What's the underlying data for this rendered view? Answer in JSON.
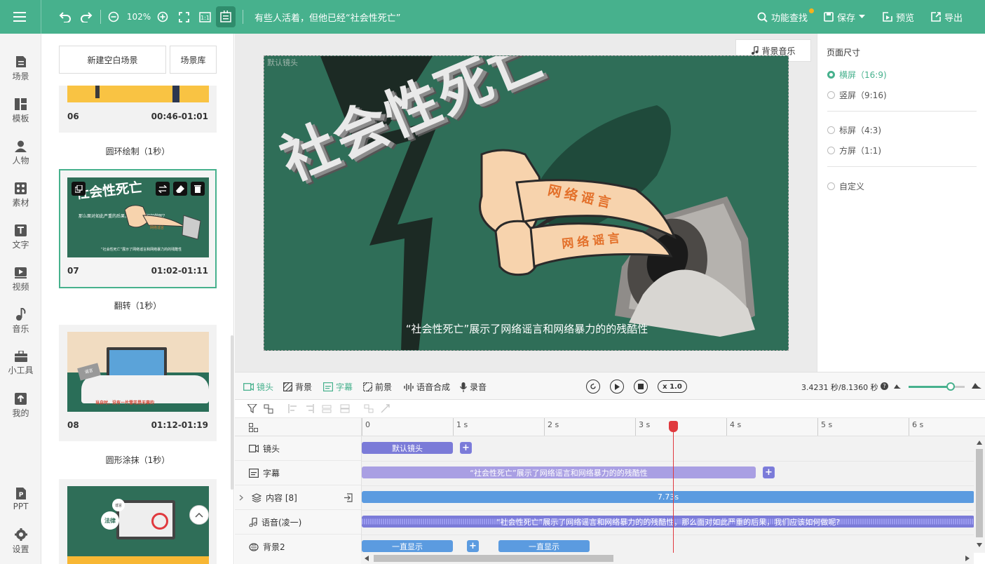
{
  "topbar": {
    "zoom": "102%",
    "project_title": "有些人活着，但他已经“社会性死亡”",
    "feature_search": "功能查找",
    "save": "保存",
    "preview": "预览",
    "export": "导出"
  },
  "nav": {
    "items": [
      {
        "label": "场景",
        "icon": "scene-icon"
      },
      {
        "label": "模板",
        "icon": "template-icon"
      },
      {
        "label": "人物",
        "icon": "person-icon"
      },
      {
        "label": "素材",
        "icon": "material-icon"
      },
      {
        "label": "文字",
        "icon": "text-icon"
      },
      {
        "label": "视频",
        "icon": "video-icon"
      },
      {
        "label": "音乐",
        "icon": "music-icon"
      },
      {
        "label": "小工具",
        "icon": "toolbox-icon"
      },
      {
        "label": "我的",
        "icon": "upload-icon"
      }
    ],
    "ppt": "PPT",
    "settings": "设置"
  },
  "scenes": {
    "new_blank": "新建空白场景",
    "library": "场景库",
    "cards": [
      {
        "num": "06",
        "time": "00:46-01:01"
      },
      {
        "num": "07",
        "time": "01:02-01:11",
        "thumb_title": "社会性死亡",
        "thumb_q": "那么面对如此严重的后果，我们应该如何做呢？",
        "thumb_caption": "“社会性死亡”展示了网络谣言和网络暴力的的残酷性",
        "thumb_tag": "网络谣言"
      },
      {
        "num": "08",
        "time": "01:12-01:19",
        "thumb_tag": "谣言",
        "thumb_caption": "当自时，没有一片雪花是无辜的"
      },
      {
        "num": "",
        "time": "",
        "thumb_tag": "法律",
        "thumb_tag2": "谣言"
      }
    ],
    "transitions": [
      "圆环绘制（1秒）",
      "翻转（1秒）",
      "圆形涂抹（1秒）"
    ]
  },
  "canvas": {
    "bg_music": "背景音乐",
    "default_shot": "默认镜头",
    "title": "社会性死亡",
    "finger_text_1": "网络谣言",
    "finger_text_2": "网络谣言",
    "subtitle": "“社会性死亡”展示了网络谣言和网络暴力的的残酷性"
  },
  "page_size": {
    "title": "页面尺寸",
    "options": [
      {
        "label": "横屏（16:9)",
        "selected": true
      },
      {
        "label": "竖屏（9:16)",
        "selected": false
      },
      {
        "label": "标屏（4:3)",
        "selected": false
      },
      {
        "label": "方屏（1:1)",
        "selected": false
      },
      {
        "label": "自定义",
        "selected": false
      }
    ]
  },
  "timeline": {
    "tabs": [
      "镜头",
      "背景",
      "字幕",
      "前景",
      "语音合成",
      "录音"
    ],
    "speed": "x 1.0",
    "time_display": "3.4231 秒/8.1360 秒",
    "zoom_level": 0.75,
    "playhead_seconds": 3.4231,
    "ruler": [
      "0",
      "1 s",
      "2 s",
      "3 s",
      "4 s",
      "5 s",
      "6 s"
    ],
    "rows": [
      {
        "label": "镜头",
        "icon": "camera-icon"
      },
      {
        "label": "字幕",
        "icon": "subtitle-icon"
      },
      {
        "label": "内容 [8]",
        "icon": "expand-icon"
      },
      {
        "label": "语音(凌一)",
        "icon": "voice-icon"
      },
      {
        "label": "背景2",
        "icon": "background-icon"
      }
    ],
    "clips": {
      "shot": "默认镜头",
      "subtitle": "“社会性死亡”展示了网络谣言和网络暴力的的残酷性",
      "content": "7.73s",
      "voice": "“社会性死亡”展示了网络谣言和网络暴力的的残酷性，那么面对如此严重的后果，我们应该如何做呢?",
      "bg_1": "一直显示",
      "bg_2": "一直显示"
    }
  },
  "colors": {
    "brand": "#47b18d",
    "canvas_bg": "#2f6e58",
    "shot_clip": "#7b7bd8",
    "content_clip": "#5b9be0",
    "playhead": "#e0393e"
  }
}
